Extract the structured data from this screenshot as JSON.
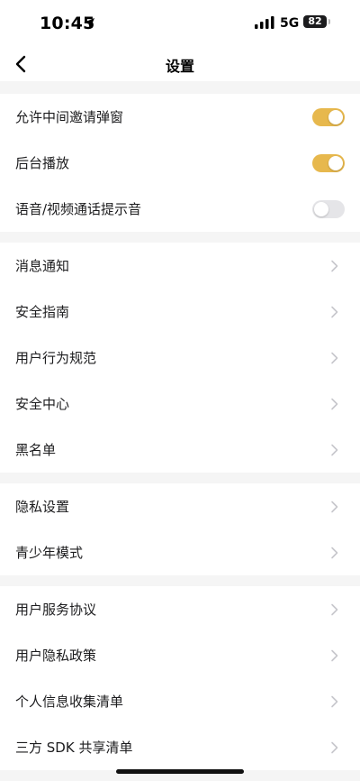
{
  "status_bar": {
    "time": "10:45",
    "network": "5G",
    "battery": "82"
  },
  "nav": {
    "title": "设置"
  },
  "colors": {
    "accent": "#e7b84d",
    "toggle_off": "#e5e5e8",
    "background": "#f5f5f5"
  },
  "groups": [
    {
      "rows": [
        {
          "label": "允许中间邀请弹窗",
          "control": "toggle",
          "on": true
        },
        {
          "label": "后台播放",
          "control": "toggle",
          "on": true
        },
        {
          "label": "语音/视频通话提示音",
          "control": "toggle",
          "on": false
        }
      ]
    },
    {
      "rows": [
        {
          "label": "消息通知",
          "control": "chevron"
        },
        {
          "label": "安全指南",
          "control": "chevron"
        },
        {
          "label": "用户行为规范",
          "control": "chevron"
        },
        {
          "label": "安全中心",
          "control": "chevron"
        },
        {
          "label": "黑名单",
          "control": "chevron"
        }
      ]
    },
    {
      "rows": [
        {
          "label": "隐私设置",
          "control": "chevron"
        },
        {
          "label": "青少年模式",
          "control": "chevron"
        }
      ]
    },
    {
      "rows": [
        {
          "label": "用户服务协议",
          "control": "chevron"
        },
        {
          "label": "用户隐私政策",
          "control": "chevron"
        },
        {
          "label": "个人信息收集清单",
          "control": "chevron"
        },
        {
          "label": "三方 SDK 共享清单",
          "control": "chevron"
        }
      ]
    }
  ]
}
